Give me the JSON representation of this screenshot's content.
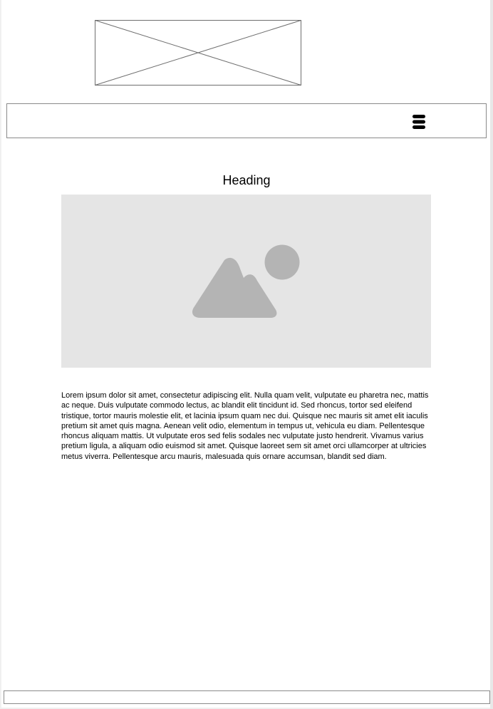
{
  "header": {
    "logo_icon": "image-placeholder-x-icon",
    "menu_icon": "hamburger-menu-icon"
  },
  "main": {
    "heading": "Heading",
    "image_icon": "landscape-image-icon",
    "body": "Lorem ipsum dolor sit amet, consectetur adipiscing elit. Nulla quam velit, vulputate eu pharetra nec, mattis ac neque. Duis vulputate commodo lectus, ac blandit elit tincidunt id. Sed rhoncus, tortor sed eleifend tristique, tortor mauris molestie elit, et lacinia ipsum quam nec dui. Quisque nec mauris sit amet elit iaculis pretium sit amet quis magna. Aenean velit odio, elementum in tempus ut, vehicula eu diam. Pellentesque rhoncus aliquam mattis. Ut vulputate eros sed felis sodales nec vulputate justo hendrerit. Vivamus varius pretium ligula, a aliquam odio euismod sit amet. Quisque laoreet sem sit amet orci ullamcorper at ultricies metus viverra. Pellentesque arcu mauris, malesuada quis ornare accumsan, blandit sed diam."
  },
  "colors": {
    "image_background": "#e5e5e5",
    "image_glyph": "#b4b4b4",
    "border": "#8a8a8a"
  }
}
